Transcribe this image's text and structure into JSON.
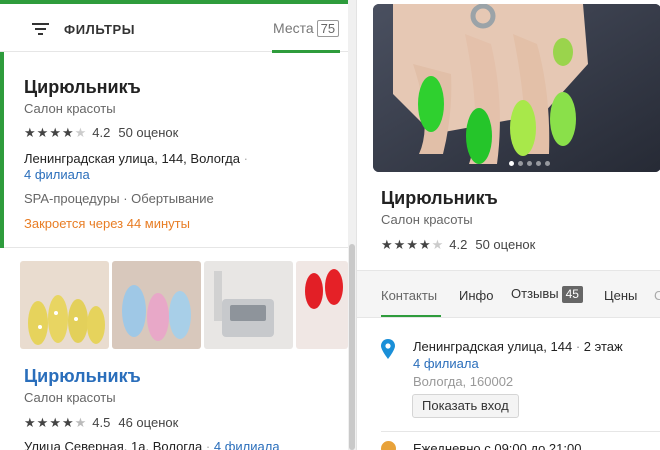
{
  "filter_bar": {
    "filters_label": "ФИЛЬТРЫ",
    "places_label": "Места",
    "places_count": "75"
  },
  "result_1": {
    "name": "Цирюльникъ",
    "category": "Салон красоты",
    "rating": "4.2",
    "rating_stars": 4.2,
    "reviews": "50 оценок",
    "address": "Ленинградская улица, 144, Вологда",
    "address_sep": "·",
    "branches": "4 филиала",
    "tags": "SPA-процедуры · Обертывание",
    "status": "Закроется через 44 минуты"
  },
  "result_2": {
    "name": "Цирюльникъ",
    "category": "Салон красоты",
    "rating": "4.5",
    "rating_stars": 4.5,
    "reviews": "46 оценок",
    "address": "Улица Северная, 1а, Вологда",
    "address_sep": "·",
    "branches": "4 филиала"
  },
  "detail": {
    "name": "Цирюльникъ",
    "category": "Салон красоты",
    "rating": "4.2",
    "rating_stars": 4.2,
    "reviews": "50 оценок",
    "tabs": [
      {
        "label": "Контакты"
      },
      {
        "label": "Инфо"
      },
      {
        "label": "Отзывы",
        "badge": "45"
      },
      {
        "label": "Цены"
      },
      {
        "label": "С"
      }
    ],
    "address": "Ленинградская улица, 144",
    "address_sep": "·",
    "floor": "2 этаж",
    "branches": "4 филиала",
    "city_zip": "Вологда, 160002",
    "show_entrance": "Показать вход",
    "hours": "Ежедневно с 09:00 до 21:00"
  },
  "colors": {
    "accent_green": "#2e9c3c",
    "link_blue": "#2a6ebb",
    "status_orange": "#e87d24"
  },
  "icons": [
    "filter-icon",
    "star-icon",
    "location-pin-icon",
    "clock-icon"
  ]
}
